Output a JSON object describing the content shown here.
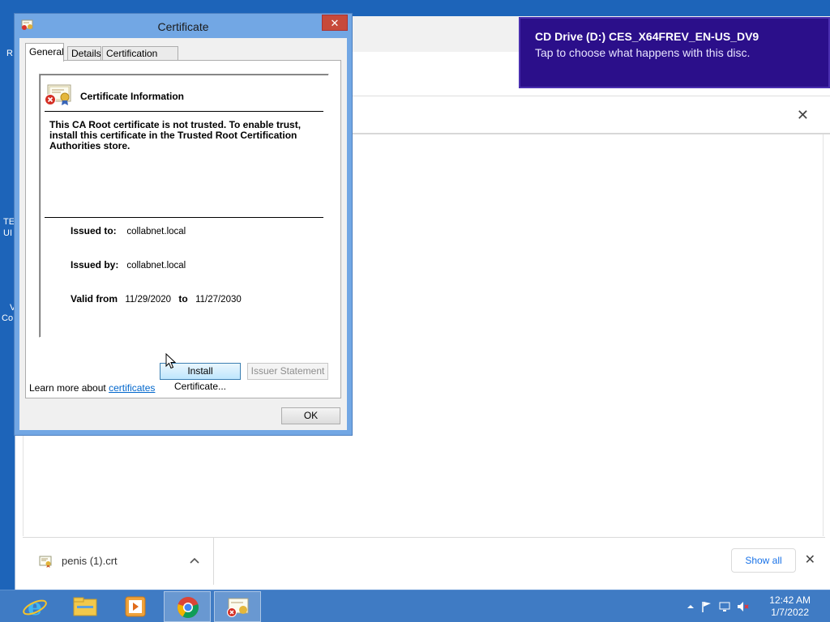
{
  "desktop": {
    "fragments": [
      "R",
      "TE",
      "UI",
      "V",
      "Co"
    ]
  },
  "toast": {
    "title": "CD Drive (D:) CES_X64FREV_EN-US_DV9",
    "subtitle": "Tap to choose what happens with this disc."
  },
  "dialog": {
    "title": "Certificate",
    "close_glyph": "✕",
    "tabs": [
      "General",
      "Details",
      "Certification Path"
    ],
    "heading": "Certificate Information",
    "message": "This CA Root certificate is not trusted. To enable trust, install this certificate in the Trusted Root Certification Authorities store.",
    "issued_to_label": "Issued to:",
    "issued_to_value": "collabnet.local",
    "issued_by_label": "Issued by:",
    "issued_by_value": "collabnet.local",
    "valid_from_label": "Valid from",
    "valid_from_value": "11/29/2020",
    "valid_to_label": "to",
    "valid_to_value": "11/27/2030",
    "install_button": "Install Certificate...",
    "issuer_statement_button": "Issuer Statement",
    "learn_more_prefix": "Learn more about",
    "learn_more_link": "certificates",
    "ok_button": "OK"
  },
  "browser": {
    "infobar_close": "✕",
    "download": {
      "filename": "penis (1).crt",
      "chevron": "^"
    },
    "show_all": "Show all",
    "shelf_close": "✕"
  },
  "taskbar": {
    "apps": [
      "internet-explorer",
      "file-explorer",
      "media-player",
      "chrome",
      "certificate"
    ],
    "time": "12:42 AM",
    "date": "1/7/2022"
  },
  "colors": {
    "desktop": "#1d64b9",
    "toast": "#2b0f8a",
    "link": "#0066cc",
    "accent": "#1a73e8"
  }
}
